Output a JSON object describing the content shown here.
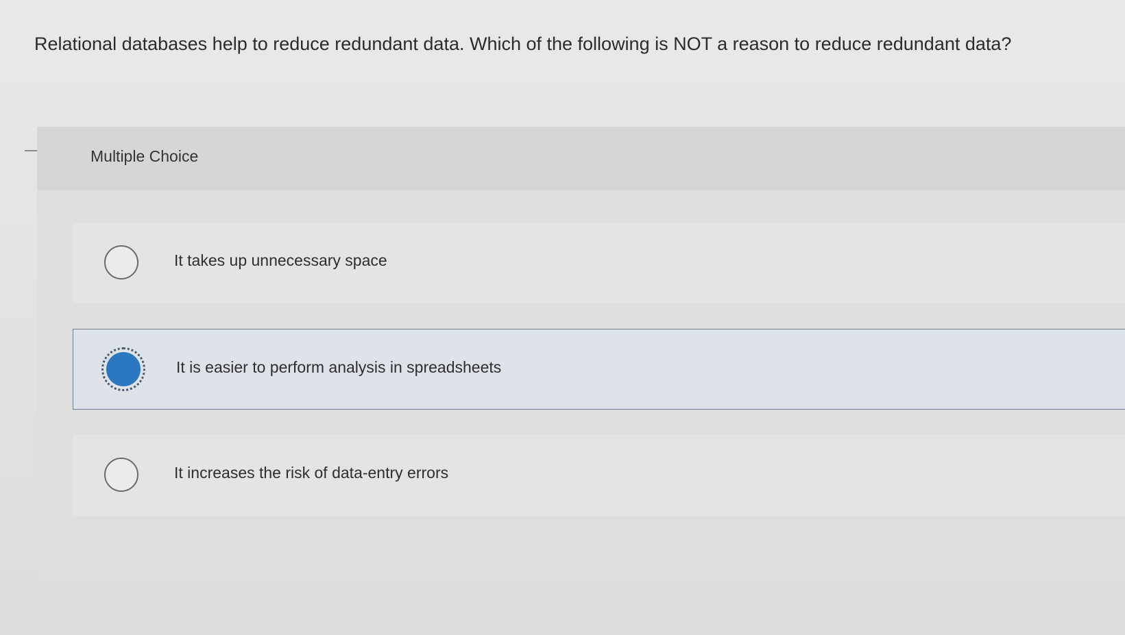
{
  "question": {
    "text": "Relational databases help to reduce redundant data. Which of the following is NOT a reason to reduce redundant data?"
  },
  "multiple_choice": {
    "label": "Multiple Choice",
    "options": [
      {
        "label": "It takes up unnecessary space",
        "selected": false
      },
      {
        "label": "It is easier to perform analysis in spreadsheets",
        "selected": true
      },
      {
        "label": "It increases the risk of data-entry errors",
        "selected": false
      }
    ]
  },
  "colors": {
    "selected_radio": "#2b77c0",
    "selected_border": "#6d7d8a",
    "background": "#e4e4e2"
  }
}
